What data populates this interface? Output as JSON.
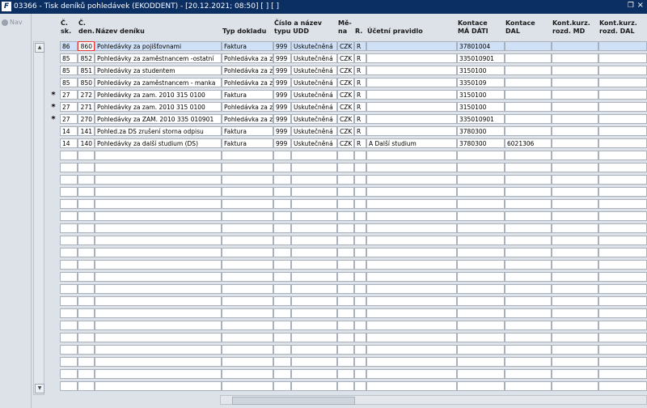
{
  "window": {
    "logo": "F",
    "title": "03366 - Tisk deníků pohledávek (EKODDENT) - [20.12.2021; 08:50] [ ] [ ]",
    "restore_icon": "❐",
    "close_icon": "×"
  },
  "nav": {
    "label": "Nav"
  },
  "columns": [
    {
      "key": "sk",
      "l1": "Č.",
      "l2": "sk."
    },
    {
      "key": "den",
      "l1": "Č.",
      "l2": "den."
    },
    {
      "key": "nazev",
      "l1": "",
      "l2": "Název deníku"
    },
    {
      "key": "typ",
      "l1": "",
      "l2": "Typ dokladu"
    },
    {
      "key": "cislo",
      "l1": "Číslo a název",
      "l2": "typu UDD"
    },
    {
      "key": "udd",
      "l1": "",
      "l2": ""
    },
    {
      "key": "mena",
      "l1": "Mě-",
      "l2": "na"
    },
    {
      "key": "r",
      "l1": "",
      "l2": "R."
    },
    {
      "key": "pravidlo",
      "l1": "",
      "l2": "Účetní pravidlo"
    },
    {
      "key": "md",
      "l1": "Kontace",
      "l2": "MÁ DÁTI"
    },
    {
      "key": "dal",
      "l1": "Kontace",
      "l2": "DAL"
    },
    {
      "key": "kmd",
      "l1": "Kont.kurz.",
      "l2": "rozd. MD"
    },
    {
      "key": "kdal",
      "l1": "Kont.kurz.",
      "l2": "rozd. DAL"
    }
  ],
  "rows": [
    {
      "marker": "",
      "sk": "86",
      "den": "860",
      "nazev": "Pohledávky za pojišťovnami",
      "typ": "Faktura",
      "cislo": "999",
      "udd": "Uskutečněná",
      "mena": "CZK",
      "r": "R",
      "pravidlo": "",
      "md": "37801004",
      "dal": "",
      "kmd": "",
      "kdal": ""
    },
    {
      "marker": "",
      "sk": "85",
      "den": "852",
      "nazev": "Pohledávky za zaměstnancem -ostatní",
      "typ": "Pohledávka za zam",
      "cislo": "999",
      "udd": "Uskutečněná",
      "mena": "CZK",
      "r": "R",
      "pravidlo": "",
      "md": "335010901",
      "dal": "",
      "kmd": "",
      "kdal": ""
    },
    {
      "marker": "",
      "sk": "85",
      "den": "851",
      "nazev": "Pohledávky za studentem",
      "typ": "Pohledávka za zam",
      "cislo": "999",
      "udd": "Uskutečněná",
      "mena": "CZK",
      "r": "R",
      "pravidlo": "",
      "md": "3150100",
      "dal": "",
      "kmd": "",
      "kdal": ""
    },
    {
      "marker": "",
      "sk": "85",
      "den": "850",
      "nazev": "Pohledávky za zaměstnancem - manka",
      "typ": "Pohledávka za zam",
      "cislo": "999",
      "udd": "Uskutečněná",
      "mena": "CZK",
      "r": "R",
      "pravidlo": "",
      "md": "3350109",
      "dal": "",
      "kmd": "",
      "kdal": ""
    },
    {
      "marker": "*",
      "sk": "27",
      "den": "272",
      "nazev": "Pohledávky za zam. 2010 315 0100",
      "typ": "Faktura",
      "cislo": "999",
      "udd": "Uskutečněná",
      "mena": "CZK",
      "r": "R",
      "pravidlo": "",
      "md": "3150100",
      "dal": "",
      "kmd": "",
      "kdal": ""
    },
    {
      "marker": "*",
      "sk": "27",
      "den": "271",
      "nazev": "Pohledávky za zam. 2010 315 0100",
      "typ": "Pohledávka za zam",
      "cislo": "999",
      "udd": "Uskutečněná",
      "mena": "CZK",
      "r": "R",
      "pravidlo": "",
      "md": "3150100",
      "dal": "",
      "kmd": "",
      "kdal": ""
    },
    {
      "marker": "*",
      "sk": "27",
      "den": "270",
      "nazev": "Pohledávky za ZAM. 2010 335 010901",
      "typ": "Pohledávka za zam",
      "cislo": "999",
      "udd": "Uskutečněná",
      "mena": "CZK",
      "r": "R",
      "pravidlo": "",
      "md": "335010901",
      "dal": "",
      "kmd": "",
      "kdal": ""
    },
    {
      "marker": "",
      "sk": "14",
      "den": "141",
      "nazev": "Pohled.za DS zrušení storna odpisu",
      "typ": "Faktura",
      "cislo": "999",
      "udd": "Uskutečněná",
      "mena": "CZK",
      "r": "R",
      "pravidlo": "",
      "md": "3780300",
      "dal": "",
      "kmd": "",
      "kdal": ""
    },
    {
      "marker": "",
      "sk": "14",
      "den": "140",
      "nazev": "Pohledávky za další studium (DS)",
      "typ": "Faktura",
      "cislo": "999",
      "udd": "Uskutečněná",
      "mena": "CZK",
      "r": "R",
      "pravidlo": "A Další studium",
      "md": "3780300",
      "dal": "6021306",
      "kmd": "",
      "kdal": ""
    }
  ],
  "empty_rows": 20,
  "scroll": {
    "up_icon": "▲",
    "down_icon": "▼",
    "left_icon": "◀",
    "right_icon": "▶"
  }
}
